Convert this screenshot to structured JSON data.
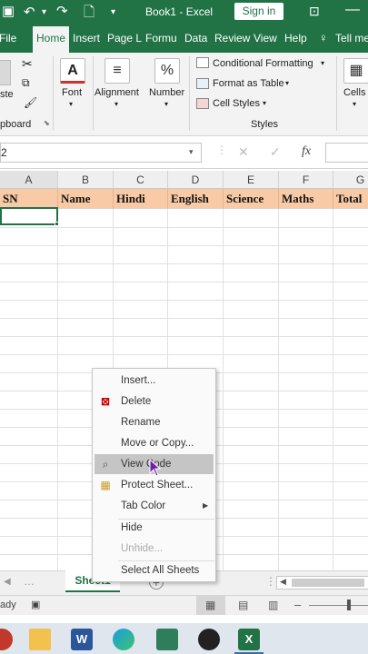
{
  "title_bar": {
    "doc_title": "Book1 - Excel",
    "sign_in": "Sign in"
  },
  "tabs": [
    "File",
    "Home",
    "Insert",
    "Page L",
    "Formu",
    "Data",
    "Review",
    "View",
    "Help",
    "Tell me"
  ],
  "ribbon": {
    "paste_label": "ste",
    "clipboard_label": "pboard",
    "font_label": "Font",
    "alignment_label": "Alignment",
    "number_label": "Number",
    "number_symbol": "%",
    "conditional_formatting": "Conditional Formatting",
    "format_as_table": "Format as Table",
    "cell_styles": "Cell Styles",
    "styles_label": "Styles",
    "cells_label": "Cells"
  },
  "formula_bar": {
    "name_box": "2",
    "fx": "fx",
    "value": ""
  },
  "columns": [
    "A",
    "B",
    "C",
    "D",
    "E",
    "F",
    "G"
  ],
  "header_row": [
    "SN",
    "Name",
    "Hindi",
    "English",
    "Science",
    "Maths",
    "Total"
  ],
  "context_menu": [
    {
      "label": "Insert...",
      "icon": "",
      "disabled": false
    },
    {
      "label": "Delete",
      "icon": "delete-sheet-icon",
      "disabled": false
    },
    {
      "label": "Rename",
      "icon": "",
      "disabled": false
    },
    {
      "label": "Move or Copy...",
      "icon": "",
      "disabled": false
    },
    {
      "label": "View Code",
      "icon": "view-code-icon",
      "disabled": false,
      "highlighted": true
    },
    {
      "label": "Protect Sheet...",
      "icon": "protect-sheet-icon",
      "disabled": false
    },
    {
      "label": "Tab Color",
      "icon": "",
      "disabled": false,
      "submenu": true
    },
    {
      "label": "Hide",
      "icon": "",
      "disabled": false
    },
    {
      "label": "Unhide...",
      "icon": "",
      "disabled": true
    },
    {
      "label": "Select All Sheets",
      "icon": "",
      "disabled": false
    }
  ],
  "sheet_tabs": {
    "active": "Sheet1",
    "add": "+"
  },
  "status": {
    "ready": "ady"
  },
  "taskbar_apps": [
    "file-explorer",
    "word",
    "edge",
    "camera",
    "media",
    "excel"
  ]
}
